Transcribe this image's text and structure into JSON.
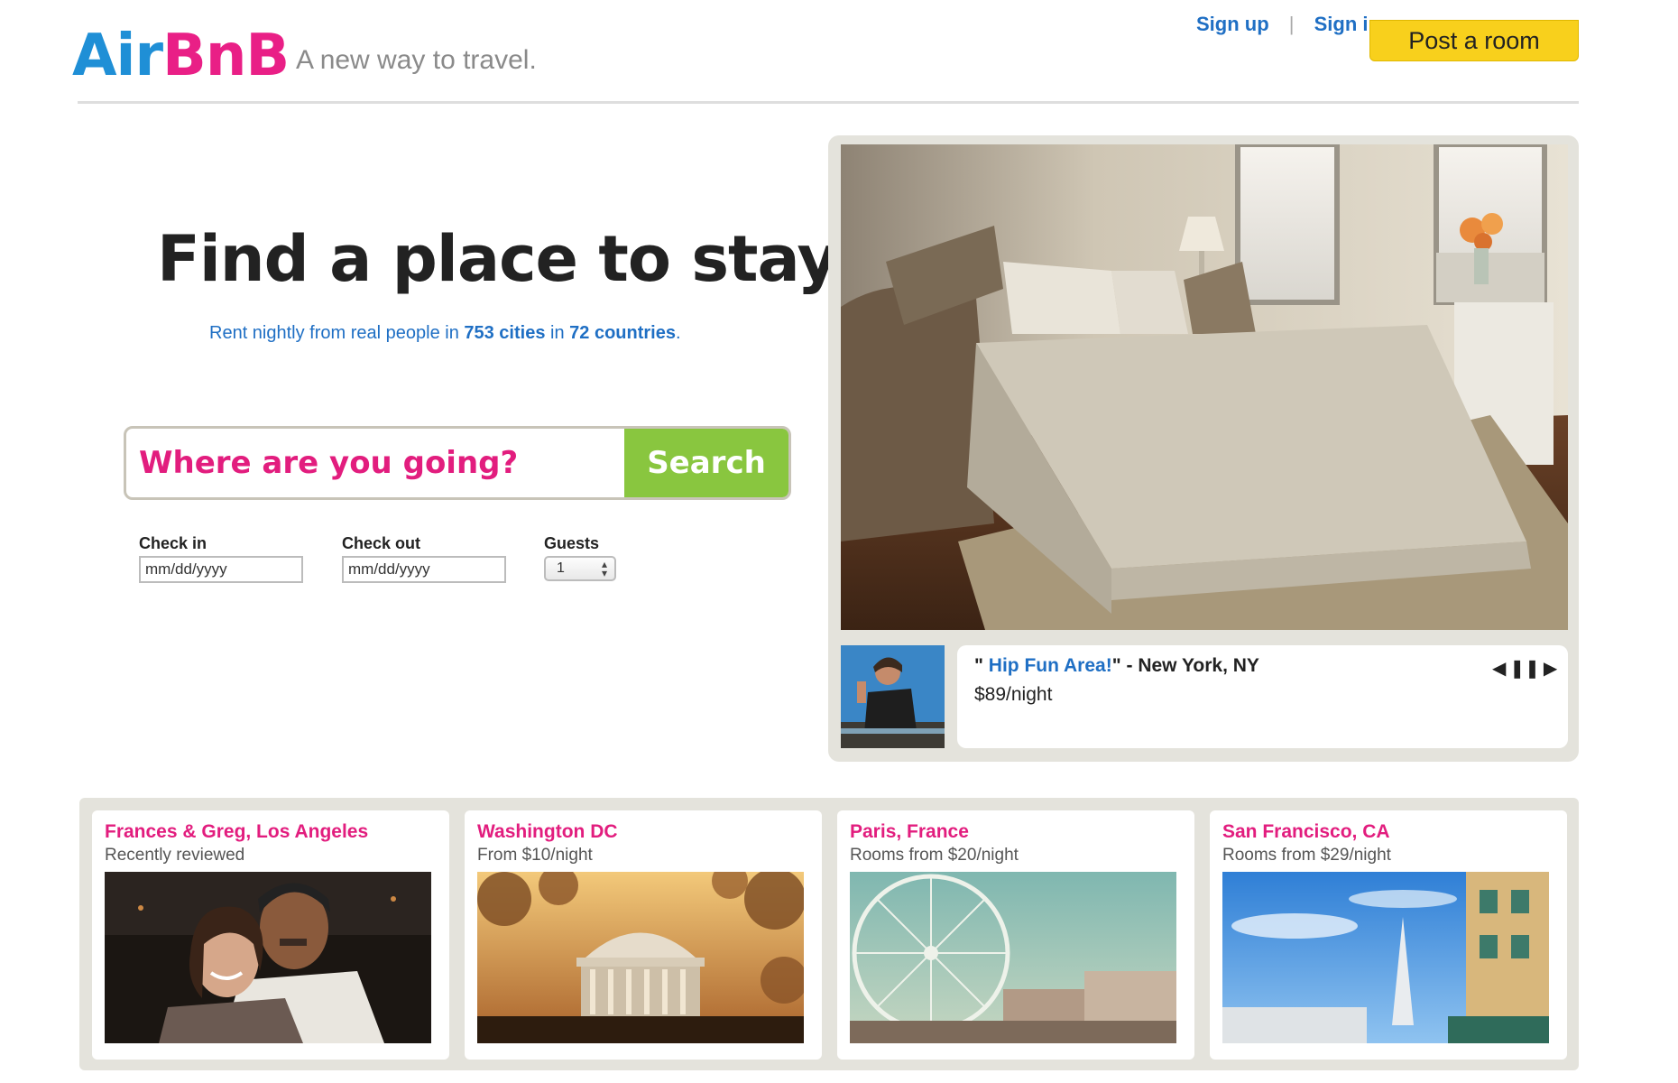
{
  "header": {
    "logo_part1": "Air",
    "logo_part2": "BnB",
    "tagline": "A new way to travel.",
    "sign_up": "Sign up",
    "separator": "|",
    "sign_in": "Sign in",
    "post_room": "Post a room"
  },
  "hero": {
    "title": "Find a place to stay.",
    "sub_pre": "Rent nightly from real people in ",
    "sub_cities": "753 cities",
    "sub_mid": " in ",
    "sub_countries": "72 countries",
    "sub_post": "."
  },
  "search": {
    "placeholder": "Where are you going?",
    "button": "Search",
    "checkin_label": "Check in",
    "checkin_value": "mm/dd/yyyy",
    "checkout_label": "Check out",
    "checkout_value": "mm/dd/yyyy",
    "guests_label": "Guests",
    "guests_value": "1"
  },
  "featured": {
    "quote_open": "\" ",
    "name": "Hip Fun Area!",
    "quote_close": "\"",
    "location": " - New York, NY",
    "price": "$89/night",
    "prev_icon": "prev-icon",
    "pause_icon": "pause-icon",
    "next_icon": "next-icon"
  },
  "cards": [
    {
      "title": "Frances & Greg, Los Angeles",
      "subtitle": "Recently reviewed"
    },
    {
      "title": "Washington DC",
      "subtitle": "From $10/night"
    },
    {
      "title": "Paris, France",
      "subtitle": "Rooms from $20/night"
    },
    {
      "title": "San Francisco, CA",
      "subtitle": "Rooms from $29/night"
    }
  ],
  "colors": {
    "brand_blue": "#1f8fd6",
    "brand_pink": "#e91f86",
    "search_green": "#89c63f",
    "post_yellow": "#f8d01c",
    "link_blue": "#1f6fc4"
  }
}
